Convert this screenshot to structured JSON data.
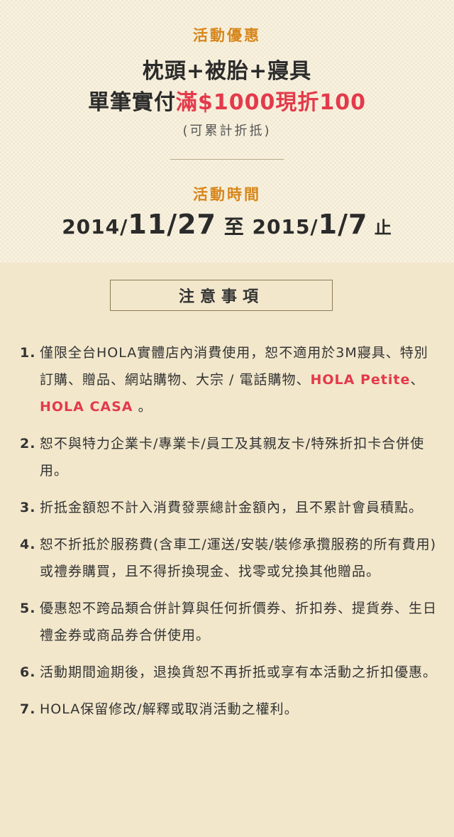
{
  "promo": {
    "label": "活動優惠",
    "line1": "枕頭+被胎+寢具",
    "line2_prefix": "單筆實付",
    "line2_highlight": "滿$1000現折100",
    "note": "(可累計折抵)"
  },
  "period": {
    "label": "活動時間",
    "start_year": "2014/",
    "start_md": "11/27",
    "to": " 至 ",
    "end_year": "2015/",
    "end_md": "1/7",
    "end_word": " 止"
  },
  "notice": {
    "title": "注意事項",
    "items": [
      {
        "num": "1.",
        "before": "僅限全台HOLA實體店內消費使用，恕不適用於3M寢具、特別訂購、贈品、網站購物、大宗 / 電話購物、",
        "hl1": "HOLA Petite",
        "mid": "、",
        "hl2": "HOLA CASA",
        "after": " 。"
      },
      {
        "num": "2.",
        "text": "恕不與特力企業卡/專業卡/員工及其親友卡/特殊折扣卡合併使用。"
      },
      {
        "num": "3.",
        "text": "折抵金額恕不計入消費發票總計金額內，且不累計會員積點。"
      },
      {
        "num": "4.",
        "text": "恕不折抵於服務費(含車工/運送/安裝/裝修承攬服務的所有費用)或禮券購買，且不得折換現金、找零或兌換其他贈品。"
      },
      {
        "num": "5.",
        "text": "優惠恕不跨品類合併計算與任何折價券、折扣券、提貨券、生日禮金券或商品券合併使用。"
      },
      {
        "num": "6.",
        "text": "活動期間逾期後，退換貨恕不再折抵或享有本活動之折扣優惠。"
      },
      {
        "num": "7.",
        "text": "HOLA保留修改/解釋或取消活動之權利。"
      }
    ]
  },
  "colors": {
    "accent": "#d7861b",
    "highlight": "#e33a4b",
    "bg": "#f2e7cb"
  }
}
